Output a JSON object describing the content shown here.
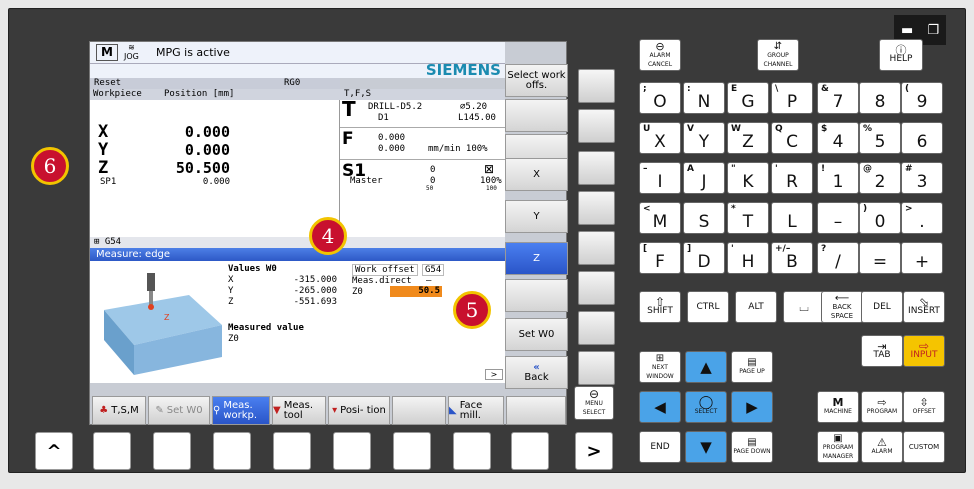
{
  "header": {
    "mode": "JOG",
    "status": "MPG is active",
    "brand": "SIEMENS",
    "reset": "Reset",
    "rg": "RG0"
  },
  "workpiece": {
    "title": "Workpiece",
    "pos_label": "Position [mm]",
    "axes": [
      {
        "name": "X",
        "value": "0.000"
      },
      {
        "name": "Y",
        "value": "0.000"
      },
      {
        "name": "Z",
        "value": "50.500"
      }
    ],
    "sp_name": "SP1",
    "sp_value": "0.000",
    "g_code": "G54"
  },
  "tfs": {
    "title": "T,F,S",
    "tool": "DRILL-D5.2",
    "diam": "⌀5.20",
    "d": "D1",
    "length": "L145.00",
    "f_val1": "0.000",
    "f_val2": "0.000",
    "f_unit": "mm/min 100%",
    "s_label": "S1",
    "s_val1": "0",
    "s_val2": "0",
    "s_pct": "100%",
    "master": "Master",
    "scale_50": "50",
    "scale_100": "100"
  },
  "measure": {
    "title": "Measure: edge",
    "values_label": "Values W0",
    "rows": [
      {
        "axis": "X",
        "val": "-315.000"
      },
      {
        "axis": "Y",
        "val": "-265.000"
      },
      {
        "axis": "Z",
        "val": "-551.693"
      }
    ],
    "wo_label": "Work offset",
    "wo_value": "G54",
    "meas_direct": "Meas.direct",
    "meas_dash": "–",
    "z0_label": "Z0",
    "z0_value": "50.5",
    "measured_label": "Measured value",
    "measured_z0": "Z0"
  },
  "softkeys": {
    "select_wo": "Select work offs.",
    "x": "X",
    "y": "Y",
    "z": "Z",
    "set_wo": "Set W0",
    "back": "Back"
  },
  "bottom_keys": {
    "tsm": "T,S,M",
    "set_wo": "Set W0",
    "meas_workp": "Meas. workp.",
    "meas_tool": "Meas. tool",
    "position": "Posi- tion",
    "face_mill": "Face mill."
  },
  "markers": {
    "m4": "4",
    "m5": "5",
    "m6": "6"
  },
  "panel_keys": {
    "alarm_cancel": "ALARM CANCEL",
    "group_channel": "GROUP CHANNEL",
    "help": "HELP",
    "menu_select": "MENU SELECT",
    "left_arrow": "^",
    "right_arrow": ">",
    "letters": [
      {
        "sub": ";",
        "main": "O"
      },
      {
        "sub": ":",
        "main": "N"
      },
      {
        "sub": "E",
        "main": "G"
      },
      {
        "sub": "\\",
        "main": "P"
      },
      {
        "sub": "U",
        "main": "X"
      },
      {
        "sub": "V",
        "main": "Y"
      },
      {
        "sub": "W",
        "main": "Z"
      },
      {
        "sub": "Q",
        "main": "C"
      },
      {
        "sub": "–",
        "main": "I"
      },
      {
        "sub": "A",
        "main": "J"
      },
      {
        "sub": "\"",
        "main": "K"
      },
      {
        "sub": "'",
        "main": "R"
      },
      {
        "sub": "<",
        "main": "M"
      },
      {
        "sub": "",
        "main": "S"
      },
      {
        "sub": "*",
        "main": "T"
      },
      {
        "sub": "",
        "main": "L"
      },
      {
        "sub": "[",
        "main": "F"
      },
      {
        "sub": "]",
        "main": "D"
      },
      {
        "sub": "'",
        "main": "H"
      },
      {
        "sub": "+/–",
        "main": "B"
      }
    ],
    "nums": [
      {
        "sub": "&",
        "main": "7"
      },
      {
        "sub": "",
        "main": "8"
      },
      {
        "sub": "(",
        "main": "9"
      },
      {
        "sub": "$",
        "main": "4"
      },
      {
        "sub": "%",
        "main": "5"
      },
      {
        "sub": "",
        "main": "6"
      },
      {
        "sub": "!",
        "main": "1"
      },
      {
        "sub": "@",
        "main": "2"
      },
      {
        "sub": "#",
        "main": "3"
      },
      {
        "sub": "",
        "main": "–"
      },
      {
        "sub": ")",
        "main": "0"
      },
      {
        "sub": ">",
        "main": "."
      },
      {
        "sub": "?",
        "main": "/"
      },
      {
        "sub": "",
        "main": "="
      },
      {
        "sub": "",
        "main": "+"
      }
    ],
    "shift": "SHIFT",
    "ctrl": "CTRL",
    "alt": "ALT",
    "back_space": "BACK SPACE",
    "del": "DEL",
    "insert": "INSERT",
    "tab": "TAB",
    "input": "INPUT",
    "next_window": "NEXT WINDOW",
    "page_up": "PAGE UP",
    "end": "END",
    "select": "SELECT",
    "page_down": "PAGE DOWN",
    "machine": "MACHINE",
    "program": "PROGRAM",
    "offset": "OFFSET",
    "program_manager": "PROGRAM MANAGER",
    "alarm": "ALARM",
    "custom": "CUSTOM"
  }
}
